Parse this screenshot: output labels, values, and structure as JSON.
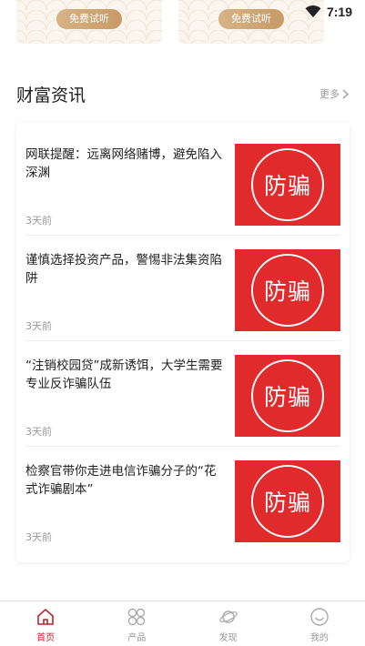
{
  "status_bar": {
    "time": "7:19",
    "icons": [
      "wifi-icon"
    ]
  },
  "top_cards": [
    {
      "button_label": "免费试听"
    },
    {
      "button_label": "免费试听"
    }
  ],
  "section": {
    "title": "财富资讯",
    "more_label": "更多"
  },
  "news": [
    {
      "title": "网联提醒：远离网络赌博，避免陷入深渊",
      "time": "3天前",
      "thumb_text": "防骗"
    },
    {
      "title": "谨慎选择投资产品，警惕非法集资陷阱",
      "time": "3天前",
      "thumb_text": "防骗"
    },
    {
      "title": "“注销校园贷”成新诱饵，大学生需要专业反诈骗队伍",
      "time": "3天前",
      "thumb_text": "防骗"
    },
    {
      "title": "检察官带你走进电信诈骗分子的“花式诈骗剧本”",
      "time": "3天前",
      "thumb_text": "防骗"
    }
  ],
  "tabs": [
    {
      "label": "首页",
      "icon": "home-icon",
      "active": true
    },
    {
      "label": "产品",
      "icon": "grid-icon",
      "active": false
    },
    {
      "label": "发现",
      "icon": "planet-icon",
      "active": false
    },
    {
      "label": "我的",
      "icon": "smile-icon",
      "active": false
    }
  ],
  "colors": {
    "accent": "#b8222a",
    "thumb_bg": "#e02a2c",
    "gold_start": "#d7b386",
    "gold_end": "#c79a66",
    "muted": "#999999"
  }
}
